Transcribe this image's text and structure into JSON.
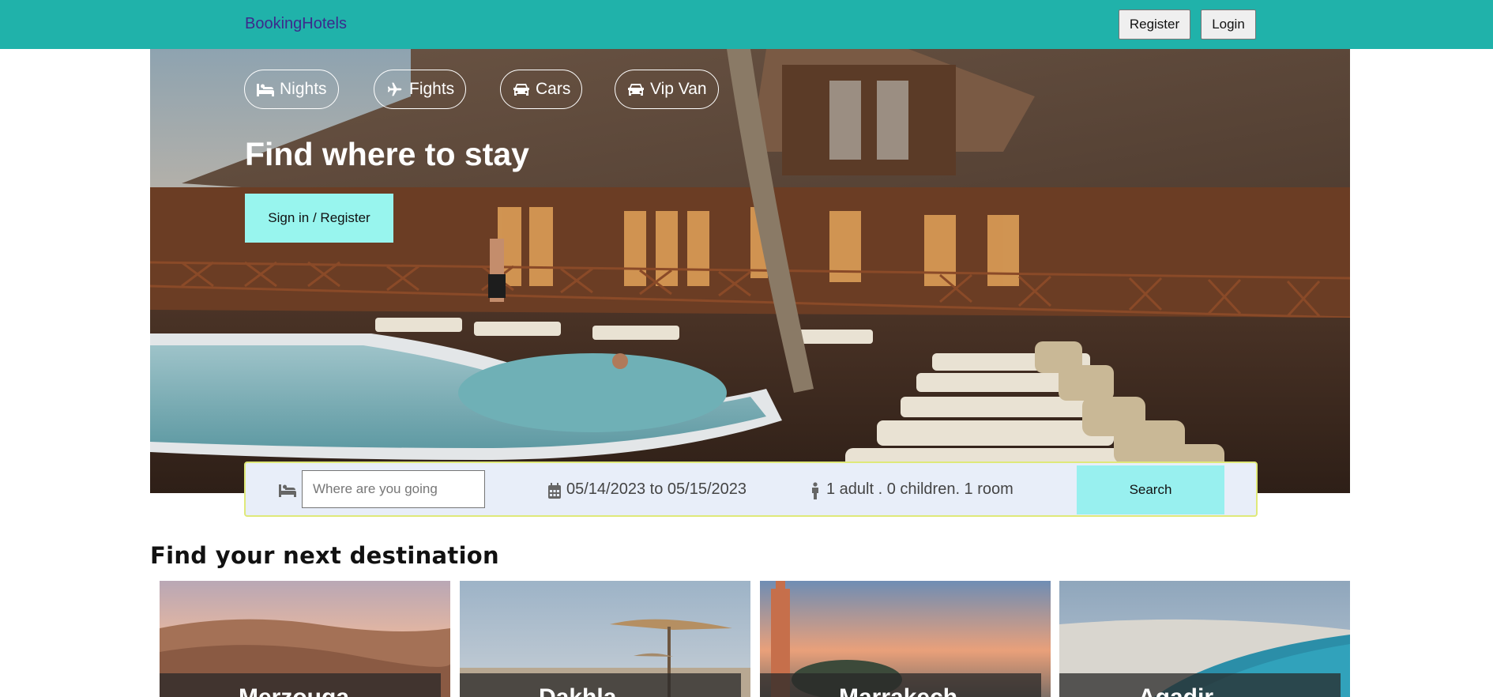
{
  "header": {
    "brand": "BookingHotels",
    "register_label": "Register",
    "login_label": "Login"
  },
  "hero": {
    "tabs": [
      {
        "label": "Nights",
        "icon": "bed-icon"
      },
      {
        "label": "Fights",
        "icon": "plane-icon"
      },
      {
        "label": "Cars",
        "icon": "car-icon"
      },
      {
        "label": "Vip Van",
        "icon": "car-icon"
      }
    ],
    "title": "Find where to stay",
    "cta_label": "Sign in / Register"
  },
  "search": {
    "destination_placeholder": "Where are you going",
    "destination_value": "",
    "dates": "05/14/2023 to 05/15/2023",
    "guests": "1 adult . 0 children. 1 room",
    "search_label": "Search"
  },
  "destinations": {
    "title": "Find your next destination",
    "cards": [
      {
        "label": "Merzouga"
      },
      {
        "label": "Dakhla"
      },
      {
        "label": "Marrakech"
      },
      {
        "label": "Agadir"
      }
    ]
  },
  "colors": {
    "topbar": "#20b2aa",
    "brand_text": "#3c2a8c",
    "cta": "#98f5ee",
    "search_bg": "#e8eef9"
  }
}
